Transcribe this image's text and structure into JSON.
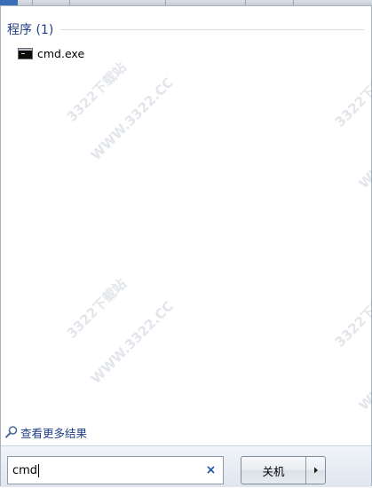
{
  "start_menu": {
    "section_title": "程序 (1)",
    "results": [
      {
        "label": "cmd.exe",
        "icon": "command-prompt-icon"
      }
    ],
    "see_more_label": "查看更多结果",
    "search": {
      "value": "cmd",
      "clear_icon": "close-icon"
    },
    "shutdown_label": "关机",
    "shutdown_arrow_icon": "chevron-right-icon"
  },
  "watermarks": {
    "site_cn": "3322下载站",
    "site_url": "WWW.3322.CC"
  },
  "colors": {
    "heading_blue": "#1e3f86",
    "watermark": "#7d8aa0"
  }
}
